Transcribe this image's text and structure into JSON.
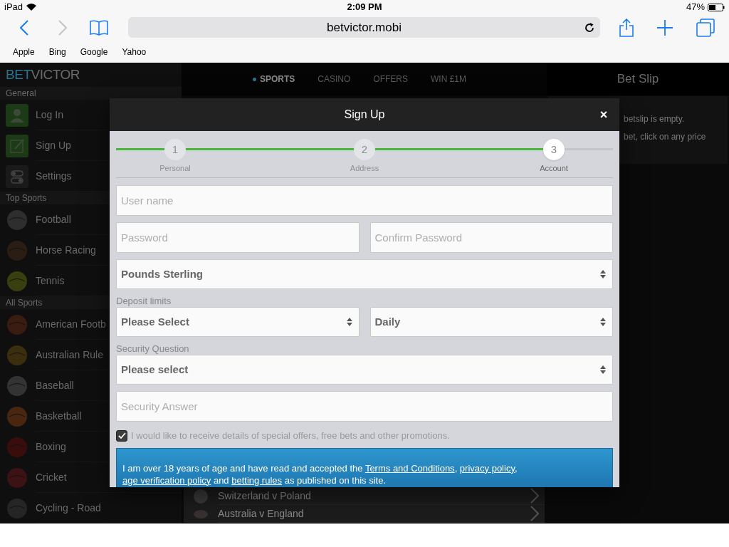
{
  "status_bar": {
    "carrier": "iPad",
    "time": "2:09 PM",
    "battery": "47%"
  },
  "browser": {
    "back": {
      "disabled": false
    },
    "forward": {
      "disabled": true
    },
    "url": "betvictor.mobi",
    "bookmarks": [
      "Apple",
      "Bing",
      "Google",
      "Yahoo"
    ]
  },
  "site": {
    "logo": {
      "first": "BET",
      "second": "VICTOR"
    },
    "nav": [
      {
        "label": "SPORTS",
        "selected": true
      },
      {
        "label": "CASINO",
        "selected": false
      },
      {
        "label": "OFFERS",
        "selected": false
      },
      {
        "label": "WIN £1M",
        "selected": false
      }
    ],
    "sidebar": [
      {
        "title": "General",
        "items": [
          "Log In",
          "Sign Up",
          "Settings"
        ]
      },
      {
        "title": "Top Sports",
        "items": [
          "Football",
          "Horse Racing",
          "Tennis"
        ]
      },
      {
        "title": "All Sports",
        "items": [
          "American Footb",
          "Australian Rule",
          "Baseball",
          "Basketball",
          "Boxing",
          "Cricket",
          "Cycling - Road"
        ]
      }
    ],
    "events": [
      "Switzerland v Poland",
      "Australia v England"
    ],
    "bet_slip": {
      "title": "Bet Slip",
      "lines": [
        "betslip is empty.",
        "bet, click on any price"
      ]
    }
  },
  "modal": {
    "title": "Sign Up",
    "close": "×",
    "steps": [
      {
        "number": "1",
        "label": "Personal",
        "selected": false
      },
      {
        "number": "2",
        "label": "Address",
        "selected": false
      },
      {
        "number": "3",
        "label": "Account",
        "selected": true
      }
    ],
    "rows": [
      {
        "kind": "input",
        "fields": [
          {
            "placeholder": "User name"
          }
        ]
      },
      {
        "kind": "input",
        "fields": [
          {
            "placeholder": "Password"
          },
          {
            "placeholder": "Confirm Password"
          }
        ]
      },
      {
        "kind": "select",
        "fields": [
          {
            "value": "Pounds Sterling"
          }
        ]
      },
      {
        "kind": "label",
        "text": "Deposit limits"
      },
      {
        "kind": "select",
        "fields": [
          {
            "value": "Please Select"
          },
          {
            "value": "Daily"
          }
        ]
      },
      {
        "kind": "label",
        "text": "Security Question"
      },
      {
        "kind": "select",
        "fields": [
          {
            "value": "Please select"
          }
        ]
      },
      {
        "kind": "input",
        "fields": [
          {
            "placeholder": "Security Answer"
          }
        ]
      },
      {
        "kind": "checkbox",
        "checked": true,
        "text": "I would like to receive details of special offers, free bets and other promotions."
      }
    ],
    "terms": [
      {
        "kind": "text",
        "text": "I am over 18 years of age and have read and accepted the "
      },
      {
        "kind": "link",
        "text": "Terms and Conditions"
      },
      {
        "kind": "text",
        "text": ", "
      },
      {
        "kind": "link",
        "text": "privacy policy"
      },
      {
        "kind": "text",
        "text": ", "
      },
      {
        "kind": "link",
        "text": "age verification policy"
      },
      {
        "kind": "text",
        "text": " and "
      },
      {
        "kind": "link",
        "text": "betting rules"
      },
      {
        "kind": "text",
        "text": " as published on this site."
      }
    ]
  }
}
